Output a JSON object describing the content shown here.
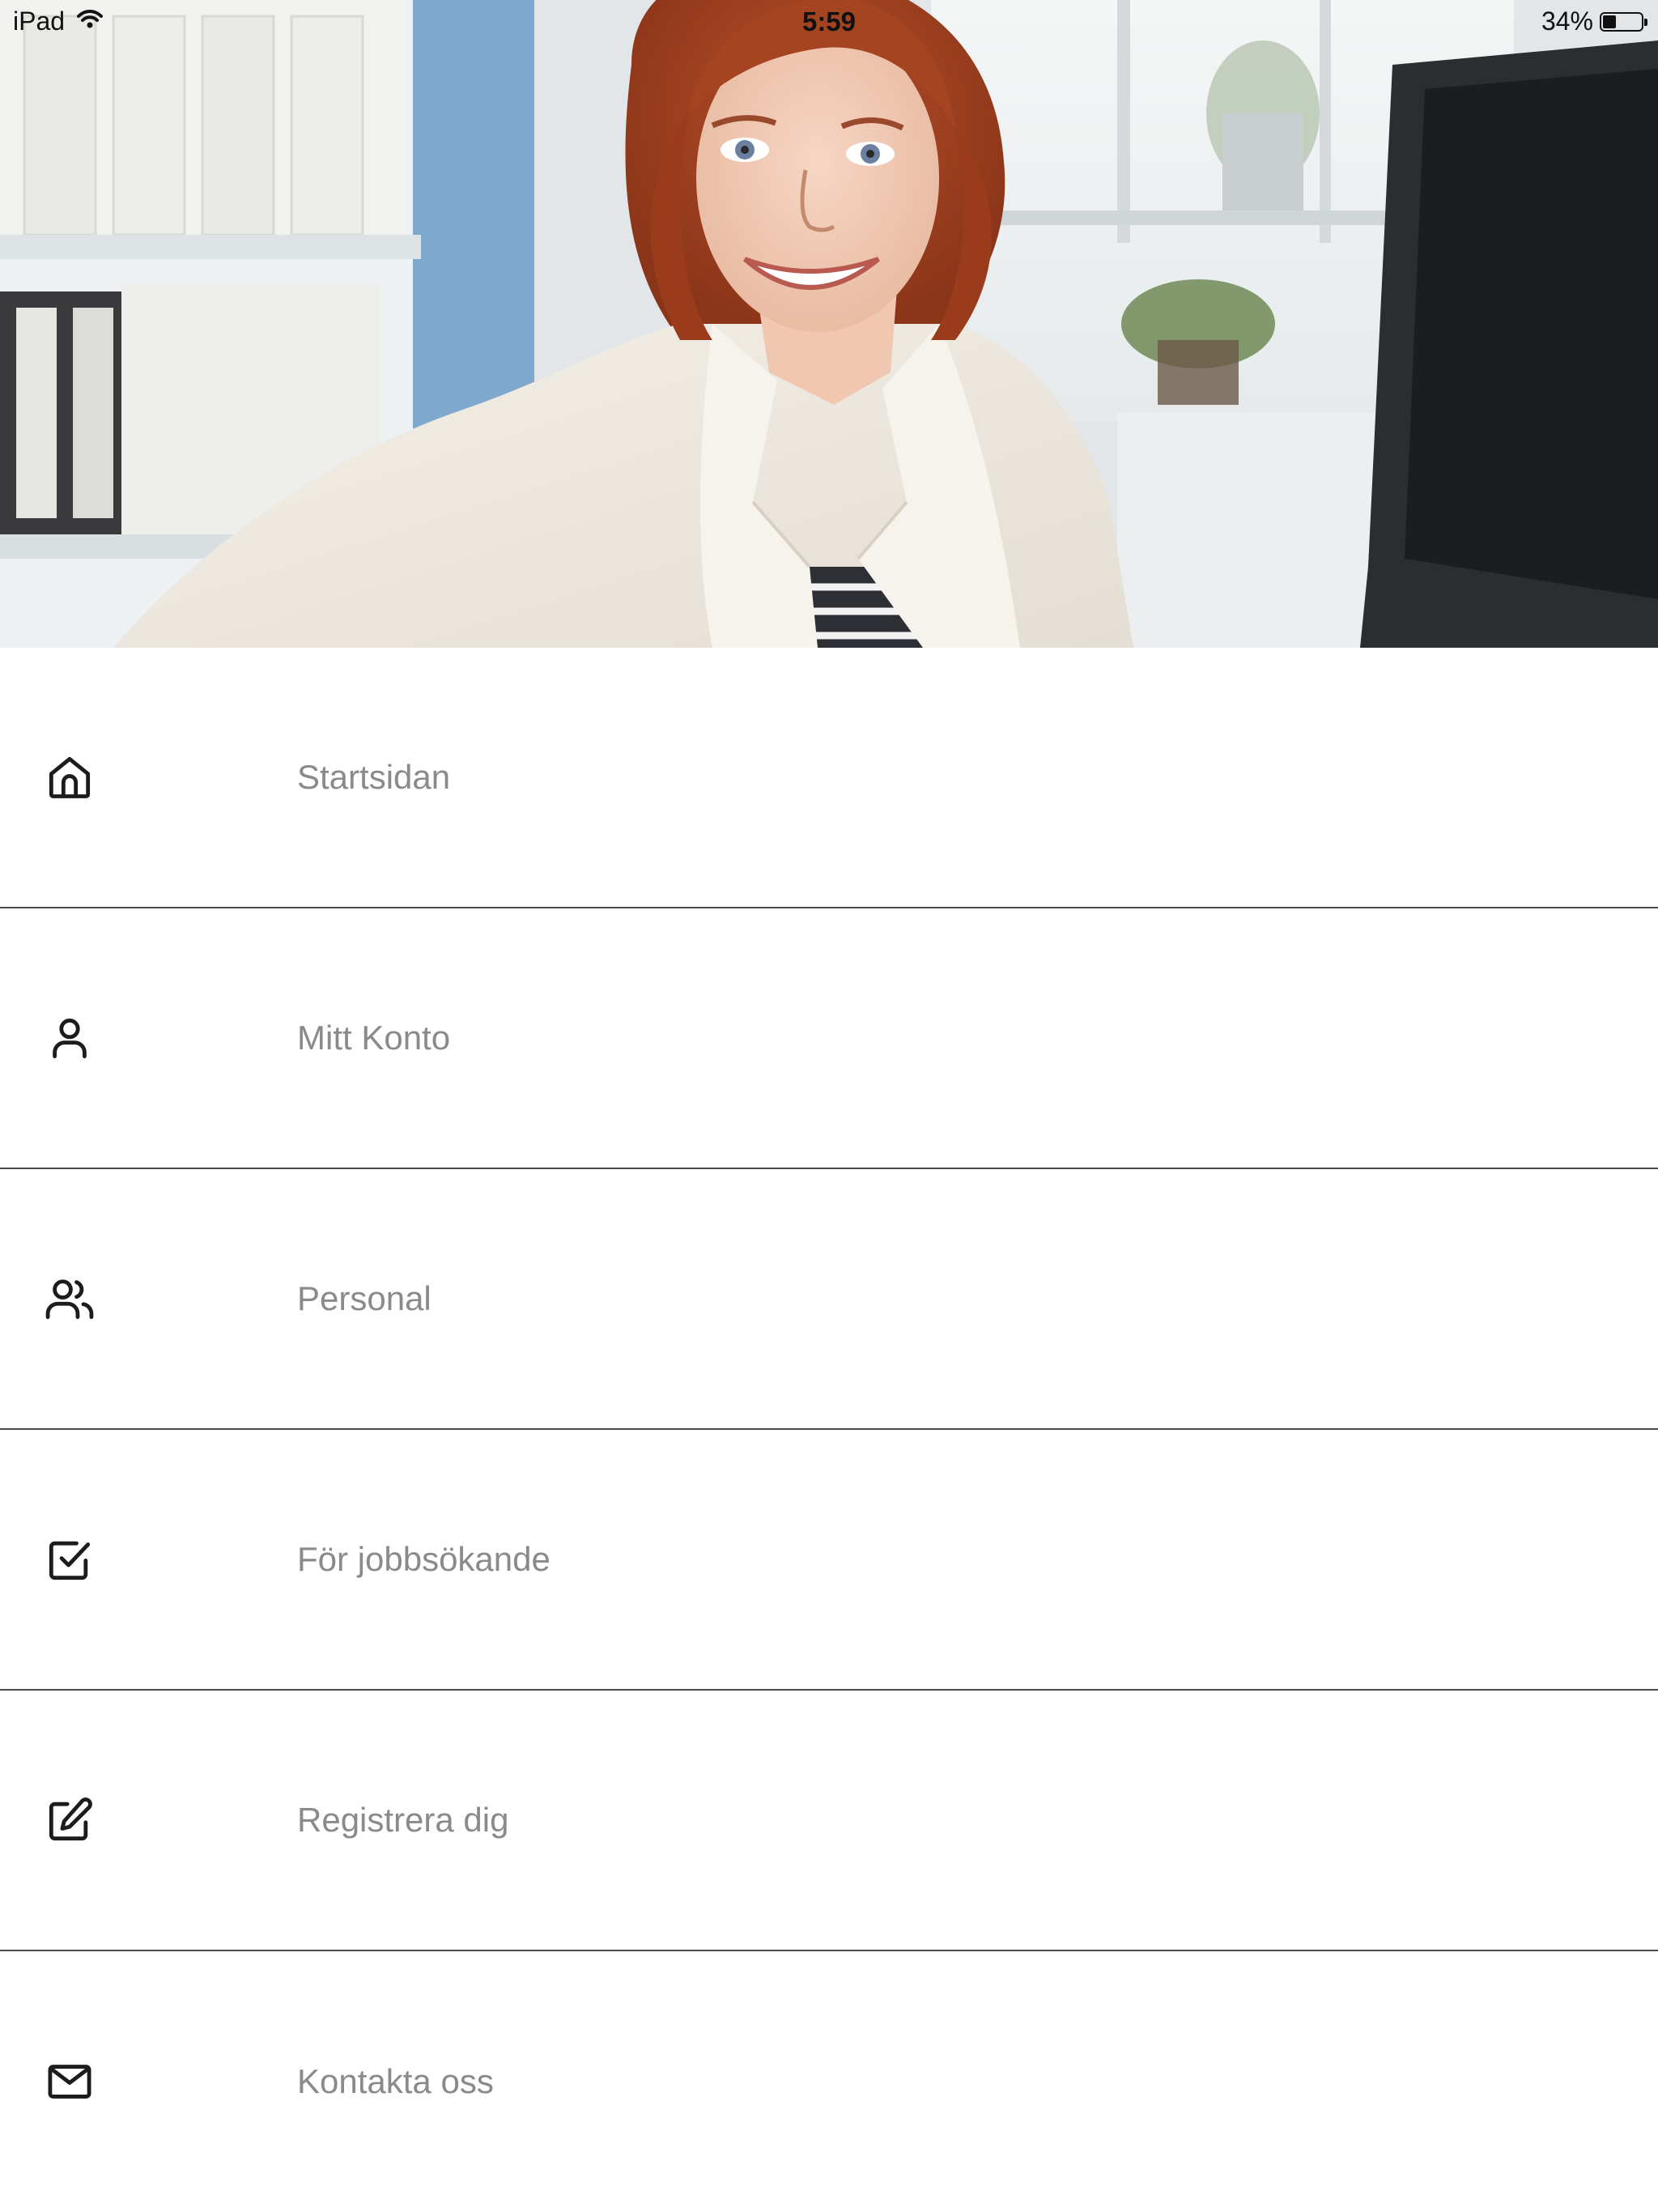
{
  "status_bar": {
    "device": "iPad",
    "time": "5:59",
    "battery_percent_text": "34%",
    "battery_level": 0.34,
    "wifi_icon": "wifi-icon",
    "battery_icon": "battery-icon"
  },
  "hero": {
    "image": "hero-photo"
  },
  "menu": {
    "items": [
      {
        "label": "Startsidan",
        "icon": "home-icon"
      },
      {
        "label": "Mitt Konto",
        "icon": "user-icon"
      },
      {
        "label": "Personal",
        "icon": "users-icon"
      },
      {
        "label": "För jobbsökande",
        "icon": "check-square-icon"
      },
      {
        "label": "Registrera dig",
        "icon": "edit-icon"
      },
      {
        "label": "Kontakta oss",
        "icon": "mail-icon"
      }
    ]
  },
  "colors": {
    "label_text": "#8a8a8a",
    "icon_stroke": "#1c1c1c",
    "divider": "#4a4a4a",
    "background": "#ffffff"
  }
}
